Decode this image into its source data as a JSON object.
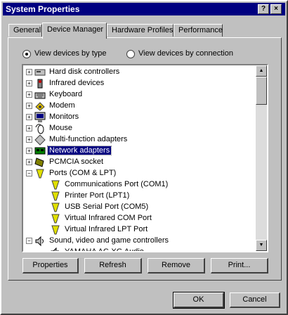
{
  "window": {
    "title": "System Properties",
    "help_btn": "?",
    "close_btn": "×"
  },
  "tabs": [
    {
      "label": "General",
      "active": false
    },
    {
      "label": "Device Manager",
      "active": true
    },
    {
      "label": "Hardware Profiles",
      "active": false
    },
    {
      "label": "Performance",
      "active": false
    }
  ],
  "view_options": {
    "by_type": "View devices by type",
    "by_connection": "View devices by connection",
    "selected": "by_type"
  },
  "tree": [
    {
      "label": "Hard disk controllers",
      "icon": "disk-controller-icon",
      "level": 0,
      "expander": "+"
    },
    {
      "label": "Infrared devices",
      "icon": "infrared-icon",
      "level": 0,
      "expander": "+"
    },
    {
      "label": "Keyboard",
      "icon": "keyboard-icon",
      "level": 0,
      "expander": "+"
    },
    {
      "label": "Modem",
      "icon": "modem-icon",
      "level": 0,
      "expander": "+"
    },
    {
      "label": "Monitors",
      "icon": "monitor-icon",
      "level": 0,
      "expander": "+"
    },
    {
      "label": "Mouse",
      "icon": "mouse-icon",
      "level": 0,
      "expander": "+"
    },
    {
      "label": "Multi-function adapters",
      "icon": "multifunction-icon",
      "level": 0,
      "expander": "+"
    },
    {
      "label": "Network adapters",
      "icon": "network-card-icon",
      "level": 0,
      "expander": "+",
      "selected": true
    },
    {
      "label": "PCMCIA socket",
      "icon": "pcmcia-icon",
      "level": 0,
      "expander": "+"
    },
    {
      "label": "Ports (COM & LPT)",
      "icon": "port-icon",
      "level": 0,
      "expander": "−"
    },
    {
      "label": "Communications Port (COM1)",
      "icon": "port-icon",
      "level": 1
    },
    {
      "label": "Printer Port (LPT1)",
      "icon": "port-icon",
      "level": 1
    },
    {
      "label": "USB Serial Port (COM5)",
      "icon": "port-icon",
      "level": 1
    },
    {
      "label": "Virtual Infrared COM Port",
      "icon": "port-icon",
      "level": 1
    },
    {
      "label": "Virtual Infrared LPT Port",
      "icon": "port-icon",
      "level": 1
    },
    {
      "label": "Sound, video and game controllers",
      "icon": "sound-icon",
      "level": 0,
      "expander": "−"
    },
    {
      "label": "YAMAHA AC-XG Audio",
      "icon": "sound-icon",
      "level": 1
    }
  ],
  "buttons": {
    "properties": "Properties",
    "refresh": "Refresh",
    "remove": "Remove",
    "print": "Print..."
  },
  "footer": {
    "ok": "OK",
    "cancel": "Cancel"
  }
}
